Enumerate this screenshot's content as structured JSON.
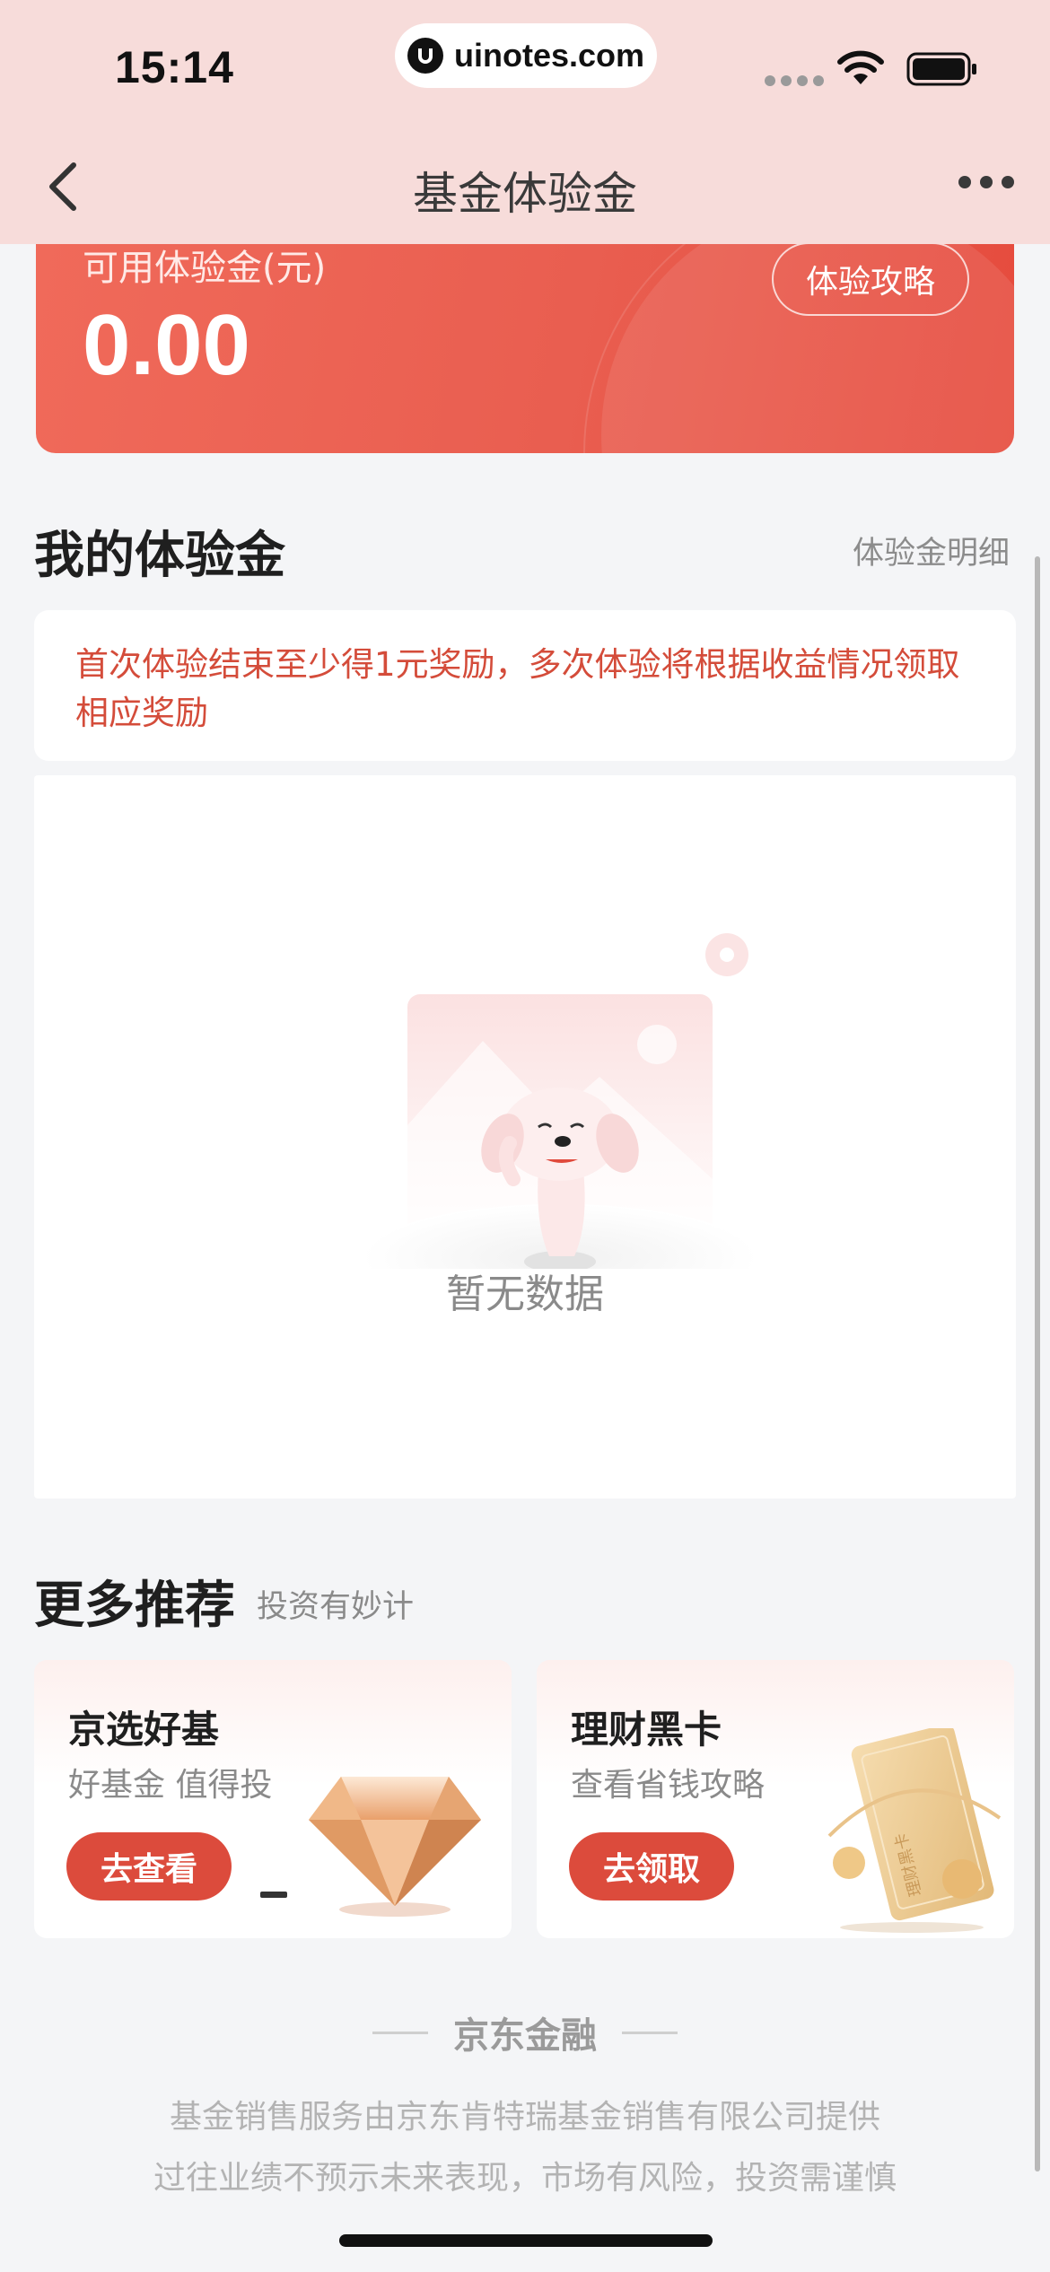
{
  "status_bar": {
    "time": "15:14",
    "url": "uinotes.com"
  },
  "nav": {
    "title": "基金体验金"
  },
  "balance": {
    "label": "可用体验金(元)",
    "value": "0.00",
    "strategy_button": "体验攻略"
  },
  "my_section": {
    "title": "我的体验金",
    "detail_link": "体验金明细",
    "notice": "首次体验结束至少得1元奖励，多次体验将根据收益情况领取相应奖励",
    "empty_text": "暂无数据"
  },
  "recommend": {
    "title": "更多推荐",
    "subtitle": "投资有妙计",
    "cards": [
      {
        "title": "京选好基",
        "subtitle": "好基金 值得投",
        "button": "去查看",
        "icon": "diamond-icon"
      },
      {
        "title": "理财黑卡",
        "subtitle": "查看省钱攻略",
        "button": "去领取",
        "icon": "card-icon",
        "card_text": "理财黑卡"
      }
    ]
  },
  "footer": {
    "brand": "京东金融",
    "line1": "基金销售服务由京东肯特瑞基金销售有限公司提供",
    "line2": "过往业绩不预示未来表现，市场有风险，投资需谨慎"
  },
  "colors": {
    "accent": "#dc4b3c",
    "header_bg": "#f7dcda",
    "notice_text": "#d44c3a"
  }
}
